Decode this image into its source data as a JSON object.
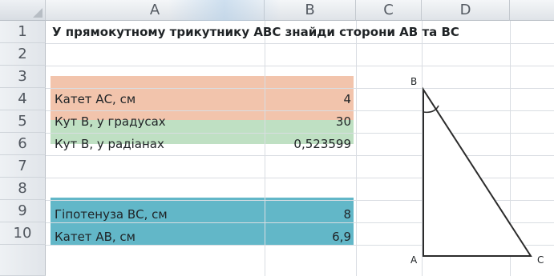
{
  "columns": [
    "A",
    "B",
    "C",
    "D"
  ],
  "rows": [
    "1",
    "2",
    "3",
    "4",
    "5",
    "6",
    "7",
    "8",
    "9",
    "10"
  ],
  "title": "У прямокутному трикутнику АВС знайди сторони АВ та ВС",
  "cells": {
    "a3": "Катет АС, см",
    "b3": "4",
    "a4": "Кут В, у градусах",
    "b4": "30",
    "a5": "Кут В, у радіанах",
    "b5": "0,523599",
    "a8": "Гіпотенуза ВС, см",
    "b8": "8",
    "a9": "Катет АВ, см",
    "b9": "6,9"
  },
  "triangle": {
    "label_b": "B",
    "label_a": "A",
    "label_c": "C"
  },
  "colors": {
    "orange_fill": "#f2c4ac",
    "green_fill": "#bfe0c3",
    "teal_fill": "#62b7c8"
  }
}
